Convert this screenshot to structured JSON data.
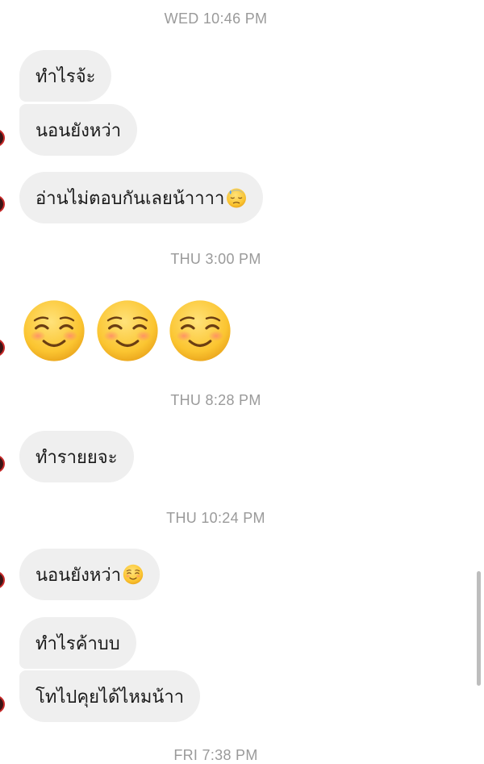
{
  "timestamps": {
    "t1": "WED 10:46 PM",
    "t2": "THU 3:00 PM",
    "t3": "THU 8:28 PM",
    "t4": "THU 10:24 PM",
    "t5": "FRI 7:38 PM"
  },
  "messages": {
    "m1": "ทำไรจ้ะ",
    "m2": "นอนยังหว่า",
    "m3": "อ่านไม่ตอบกันเลยน้าาาา",
    "m3_emoji": "downcast-face-with-sweat",
    "big_emoji": [
      "smiling-face",
      "smiling-face",
      "smiling-face"
    ],
    "m4": "ทำรายยจะ",
    "m5": "นอนยังหว่า",
    "m5_emoji": "smiling-face",
    "m6": "ทำไรค้าบบ",
    "m7": "โทไปคุยได้ไหมน้าา"
  },
  "colors": {
    "bubble": "#efefef",
    "timestamp": "#9a9a9a",
    "text": "#1a1a1a",
    "avatar_ring": "#c62828"
  }
}
